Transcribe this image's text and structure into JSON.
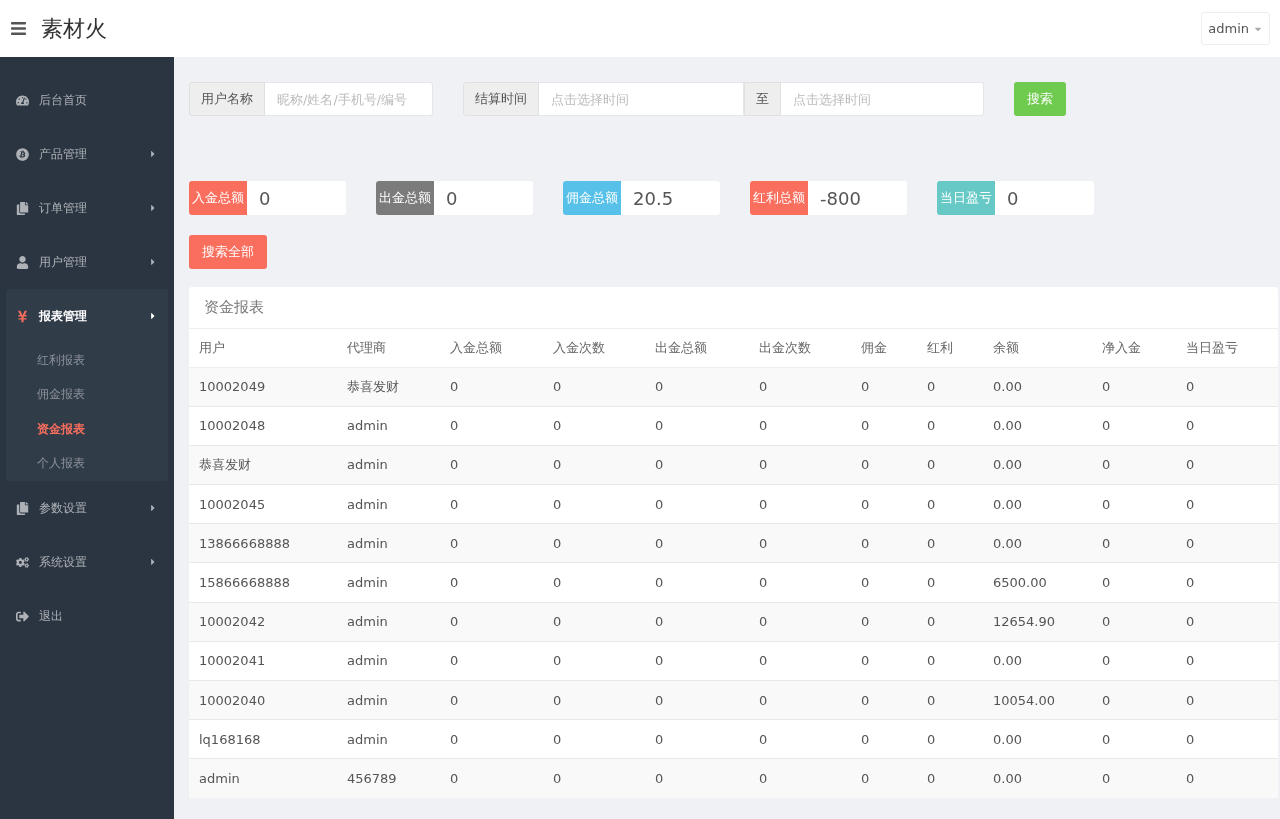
{
  "header": {
    "logo": "素材火",
    "user": "admin"
  },
  "sidebar": {
    "items": [
      {
        "label": "后台首页",
        "has_arrow": false,
        "expanded": false
      },
      {
        "label": "产品管理",
        "has_arrow": true,
        "expanded": false
      },
      {
        "label": "订单管理",
        "has_arrow": true,
        "expanded": false
      },
      {
        "label": "用户管理",
        "has_arrow": true,
        "expanded": false
      },
      {
        "label": "报表管理",
        "has_arrow": true,
        "expanded": true,
        "children": [
          {
            "label": "红利报表",
            "selected": false
          },
          {
            "label": "佣金报表",
            "selected": false
          },
          {
            "label": "资金报表",
            "selected": true
          },
          {
            "label": "个人报表",
            "selected": false
          }
        ]
      },
      {
        "label": "参数设置",
        "has_arrow": true,
        "expanded": false
      },
      {
        "label": "系统设置",
        "has_arrow": true,
        "expanded": false
      },
      {
        "label": "退出",
        "has_arrow": false,
        "expanded": false
      }
    ]
  },
  "filters": {
    "user_label": "用户名称",
    "user_placeholder": "昵称/姓名/手机号/编号",
    "time_label": "结算时间",
    "start_placeholder": "点击选择时间",
    "to_label": "至",
    "end_placeholder": "点击选择时间",
    "search_button": "搜索"
  },
  "stats": [
    {
      "label": "入金总额",
      "value": "0",
      "color": "#fa6e5e"
    },
    {
      "label": "出金总额",
      "value": "0",
      "color": "#7b7b7b"
    },
    {
      "label": "佣金总额",
      "value": "20.5",
      "color": "#57c1ea"
    },
    {
      "label": "红利总额",
      "value": "-800",
      "color": "#fa6e5e"
    },
    {
      "label": "当日盈亏",
      "value": "0",
      "color": "#66c9c6"
    }
  ],
  "search_all_button": "搜索全部",
  "table": {
    "title": "资金报表",
    "columns": [
      "用户",
      "代理商",
      "入金总额",
      "入金次数",
      "出金总额",
      "出金次数",
      "佣金",
      "红利",
      "余额",
      "净入金",
      "当日盈亏"
    ],
    "rows": [
      [
        "10002049",
        "恭喜发财",
        "0",
        "0",
        "0",
        "0",
        "0",
        "0",
        "0.00",
        "0",
        "0"
      ],
      [
        "10002048",
        "admin",
        "0",
        "0",
        "0",
        "0",
        "0",
        "0",
        "0.00",
        "0",
        "0"
      ],
      [
        "恭喜发财",
        "admin",
        "0",
        "0",
        "0",
        "0",
        "0",
        "0",
        "0.00",
        "0",
        "0"
      ],
      [
        "10002045",
        "admin",
        "0",
        "0",
        "0",
        "0",
        "0",
        "0",
        "0.00",
        "0",
        "0"
      ],
      [
        "13866668888",
        "admin",
        "0",
        "0",
        "0",
        "0",
        "0",
        "0",
        "0.00",
        "0",
        "0"
      ],
      [
        "15866668888",
        "admin",
        "0",
        "0",
        "0",
        "0",
        "0",
        "0",
        "6500.00",
        "0",
        "0"
      ],
      [
        "10002042",
        "admin",
        "0",
        "0",
        "0",
        "0",
        "0",
        "0",
        "12654.90",
        "0",
        "0"
      ],
      [
        "10002041",
        "admin",
        "0",
        "0",
        "0",
        "0",
        "0",
        "0",
        "0.00",
        "0",
        "0"
      ],
      [
        "10002040",
        "admin",
        "0",
        "0",
        "0",
        "0",
        "0",
        "0",
        "10054.00",
        "0",
        "0"
      ],
      [
        "lq168168",
        "admin",
        "0",
        "0",
        "0",
        "0",
        "0",
        "0",
        "0.00",
        "0",
        "0"
      ],
      [
        "admin",
        "456789",
        "0",
        "0",
        "0",
        "0",
        "0",
        "0",
        "0.00",
        "0",
        "0"
      ]
    ]
  }
}
